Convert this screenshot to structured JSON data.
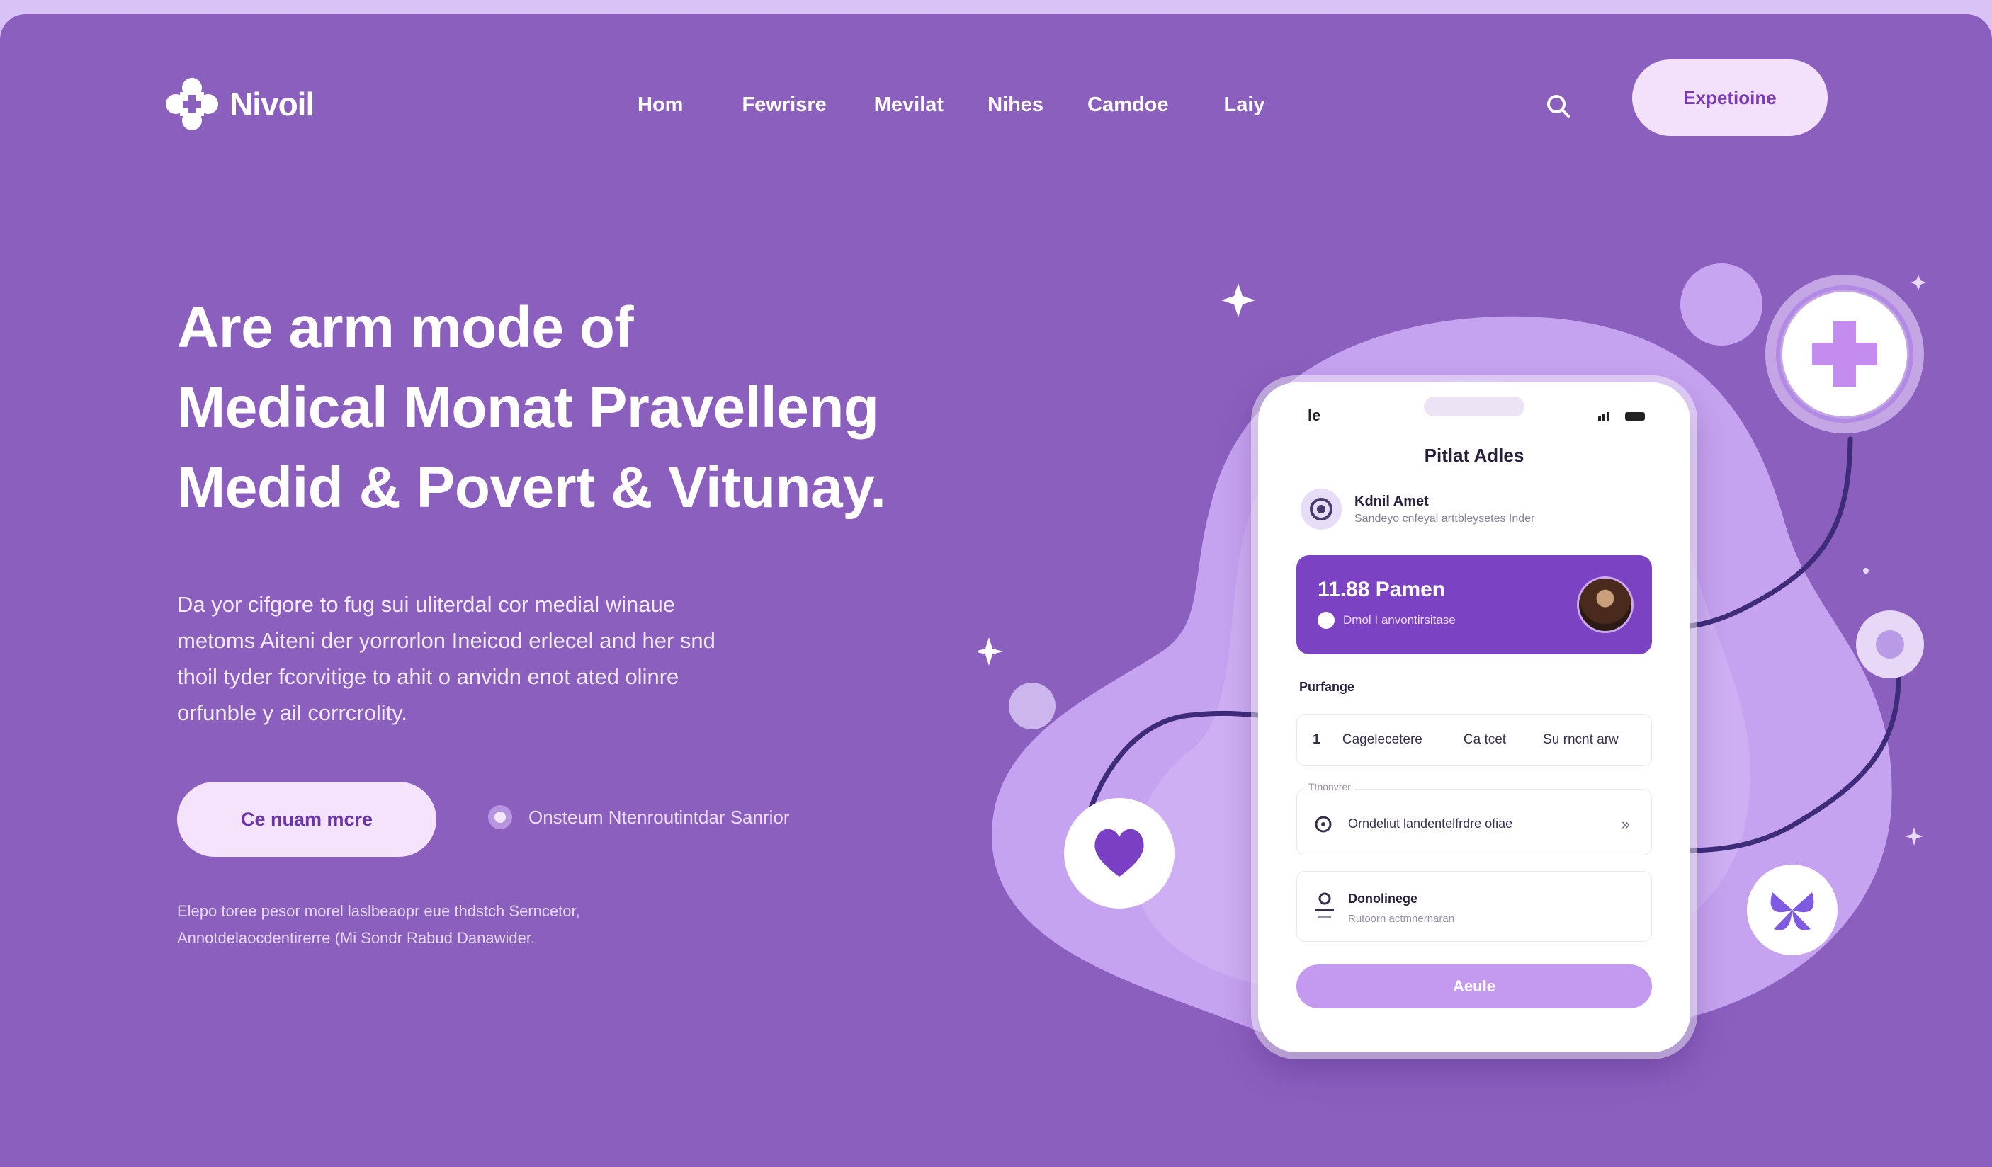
{
  "brand": {
    "name": "Nivoil",
    "logo_icon": "medical-cross-logo"
  },
  "nav": {
    "items": [
      {
        "label": "Hom"
      },
      {
        "label": "Fewrisre"
      },
      {
        "label": "Mevilat"
      },
      {
        "label": "Nihes"
      },
      {
        "label": "Camdoe"
      },
      {
        "label": "Laiy"
      }
    ]
  },
  "header": {
    "search_icon": "search-icon",
    "cta_label": "Expetioine"
  },
  "hero": {
    "title_lines": [
      "Are arm mode of",
      "Medical Monat Pravelleng",
      "Medid & Povert & Vitunay."
    ],
    "description_lines": [
      "Da yor cifgore to fug sui uliterdal cor medial winaue",
      "metoms Aiteni der yorrorlon Ineicod erlecel and her snd",
      "thoil tyder fcorvitige to ahit o anvidn enot ated olinre",
      "orfunble y ail corrcrolity."
    ],
    "cta_label": "Ce nuam mcre",
    "secondary_link": "Onsteum Ntenroutintdar Sanrior",
    "fine_print_lines": [
      "Elepo toree pesor morel laslbeaopr eue thdstch Serncetor,",
      "Annotdelaocdentirerre (Mi Sondr Rabud Danawider."
    ]
  },
  "phone": {
    "status_time": "le",
    "app_title": "Pitlat Adles",
    "profile": {
      "name": "Kdnil Amet",
      "subtitle": "Sandeyo cnfeyal arttbleysetes Inder"
    },
    "card": {
      "amount": "11.88 Pamen",
      "subtitle": "Dmol I anvontirsitase"
    },
    "section_label": "Purfange",
    "tabs": [
      {
        "num": "1",
        "label": "Cagelecetere"
      },
      {
        "label": "Ca tcet"
      },
      {
        "label": "Su rncnt arw"
      }
    ],
    "rows": [
      {
        "tag": "Ttnonvrer",
        "text": "Orndeliut landentelfrdre ofiae",
        "arrow": "»"
      },
      {
        "title": "Donolinege",
        "subtitle": "Rutoorn actmnernaran"
      }
    ],
    "button_label": "Aeule"
  },
  "colors": {
    "background": "#8a5fbe",
    "accent_light": "#f3e1fb",
    "card": "#7b42c4",
    "blob": "#c9a6f2"
  }
}
